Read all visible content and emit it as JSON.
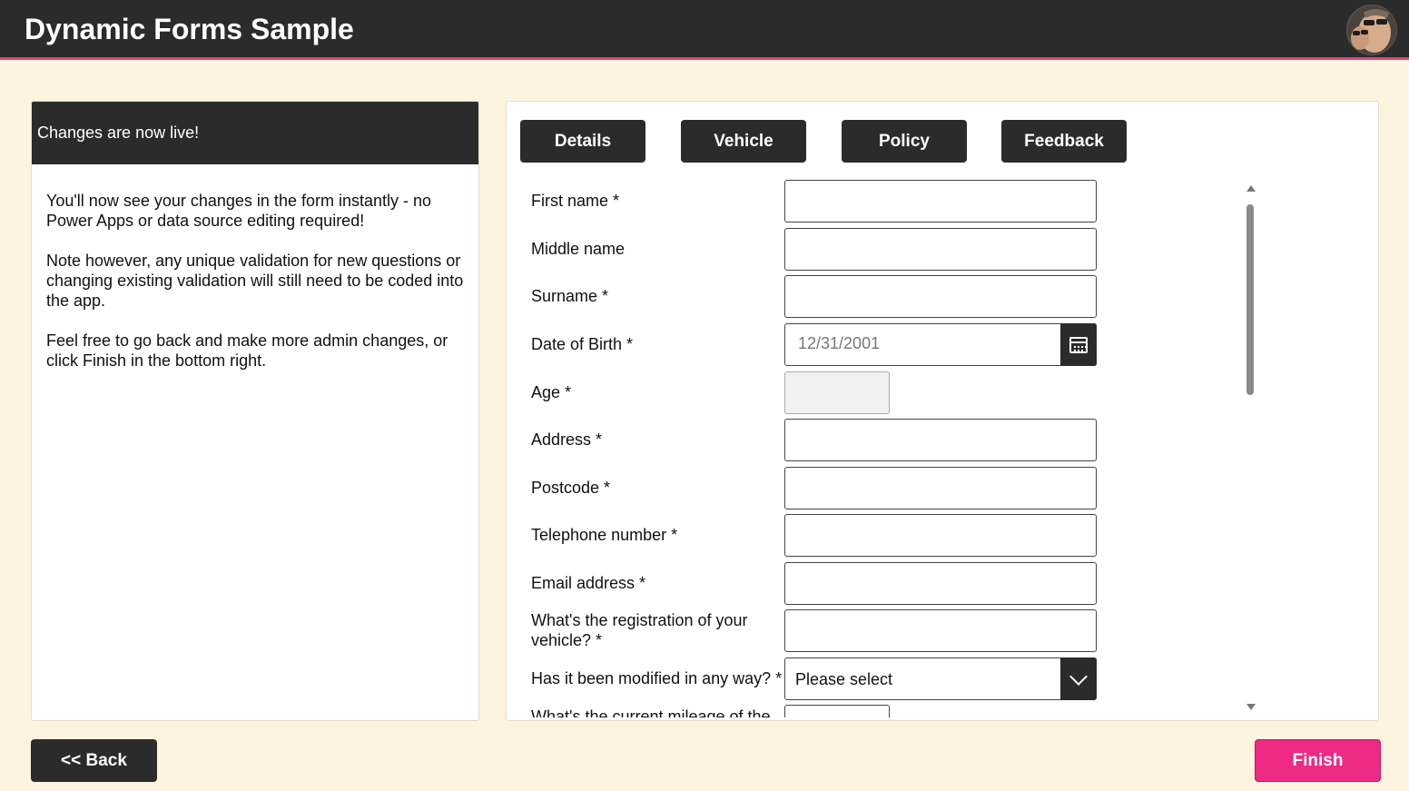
{
  "app": {
    "title": "Dynamic Forms Sample"
  },
  "colors": {
    "header_bg": "#2b2b2b",
    "accent": "#ef2a84",
    "page_bg": "#fdf4e0"
  },
  "info_panel": {
    "header": "Changes are now live!",
    "paragraphs": [
      "You'll now see your changes in the form instantly - no Power Apps or data source editing required!",
      "Note however, any unique validation for new questions or changing existing validation will still need to be coded into the app.",
      "Feel free to go back and make more admin changes, or click Finish in the bottom right."
    ]
  },
  "tabs": [
    "Details",
    "Vehicle",
    "Policy",
    "Feedback"
  ],
  "form": {
    "fields": [
      {
        "label": "First name *",
        "value": ""
      },
      {
        "label": "Middle name",
        "value": ""
      },
      {
        "label": "Surname *",
        "value": ""
      },
      {
        "label": "Date of Birth *",
        "value": "12/31/2001",
        "icon": "calendar-icon"
      },
      {
        "label": "Age *",
        "value": ""
      },
      {
        "label": "Address *",
        "value": ""
      },
      {
        "label": "Postcode *",
        "value": ""
      },
      {
        "label": "Telephone number *",
        "value": ""
      },
      {
        "label": "Email address *",
        "value": ""
      },
      {
        "label": "What's the registration of your vehicle? *",
        "value": ""
      },
      {
        "label": "Has it been modified in any way? *",
        "value": "Please select",
        "icon": "chevron-down-icon"
      },
      {
        "label": "What's the current mileage of the",
        "value": ""
      }
    ]
  },
  "footer": {
    "back_label": "<< Back",
    "finish_label": "Finish"
  }
}
